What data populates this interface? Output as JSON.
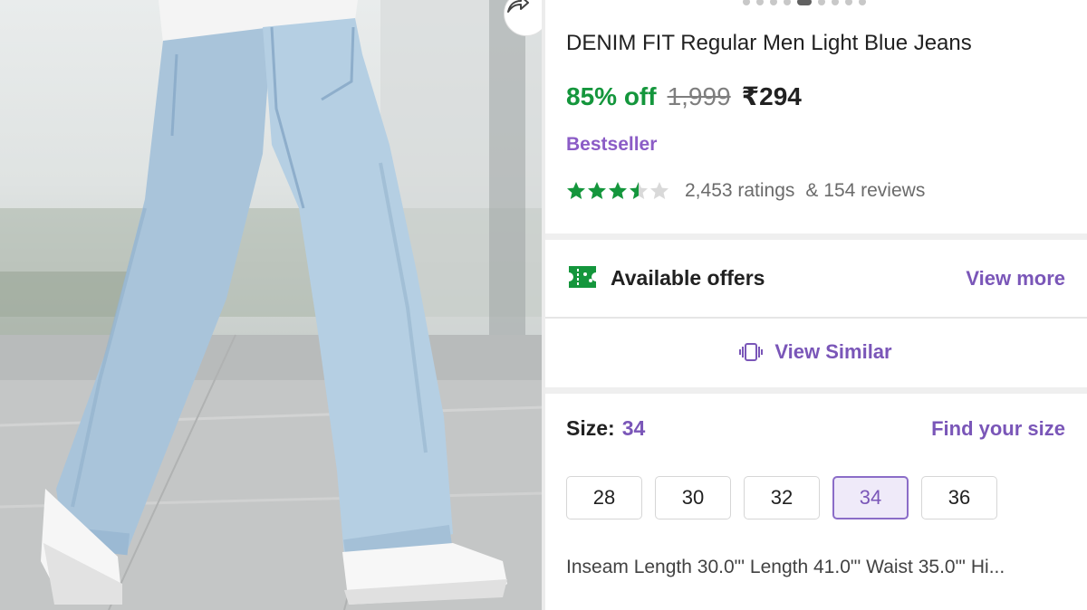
{
  "product": {
    "title": "DENIM FIT Regular Men Light Blue Jeans",
    "discount": "85% off",
    "mrp": "1,999",
    "price": "₹294",
    "badge": "Bestseller",
    "rating_value": 3.5,
    "ratings_count": "2,453 ratings",
    "reviews_count": "& 154 reviews"
  },
  "carousel": {
    "total_dots": 9,
    "active_index": 4
  },
  "offers": {
    "label": "Available offers",
    "action": "View more",
    "icon": "offer-ticket-icon"
  },
  "similar": {
    "label": "View Similar",
    "icon": "view-similar-icon"
  },
  "size": {
    "label": "Size:",
    "selected": "34",
    "find_label": "Find your size",
    "options": [
      "28",
      "30",
      "32",
      "34",
      "36"
    ]
  },
  "measurements": "Inseam Length 30.0\"'  Length 41.0\"'  Waist 35.0\"'  Hi...",
  "colors": {
    "discount_green": "#14963c",
    "accent_purple": "#7a56b8",
    "badge_purple": "#8b5cc6",
    "star_green": "#14963c"
  },
  "share_icon": "share-icon"
}
